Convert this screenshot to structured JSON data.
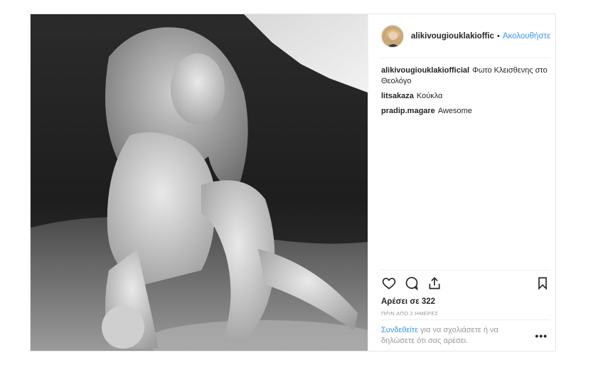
{
  "post": {
    "author": "alikivougiouklakioffic",
    "separator": "•",
    "follow_label": "Ακολουθήστε",
    "comments": [
      {
        "user": "alikivougiouklakiofficial",
        "text": "Φωτο Κλεισθενης στο Θεολόγο"
      },
      {
        "user": "litsakaza",
        "text": "Κούκλα"
      },
      {
        "user": "pradip.magare",
        "text": "Awesome"
      }
    ],
    "likes": "Αρέσει σε 322",
    "time_ago": "ΠΡΙΝ ΑΠΟ 2 ΗΜΕΡΕΣ",
    "login_link": "Συνδεθείτε",
    "login_text": " για να σχολιάσετε ή να δηλώσετε ότι σας αρέσει.",
    "more_label": "•••"
  },
  "icons": {
    "like": "heart-icon",
    "comment": "comment-icon",
    "share": "share-icon",
    "save": "bookmark-icon",
    "avatar": "avatar"
  }
}
